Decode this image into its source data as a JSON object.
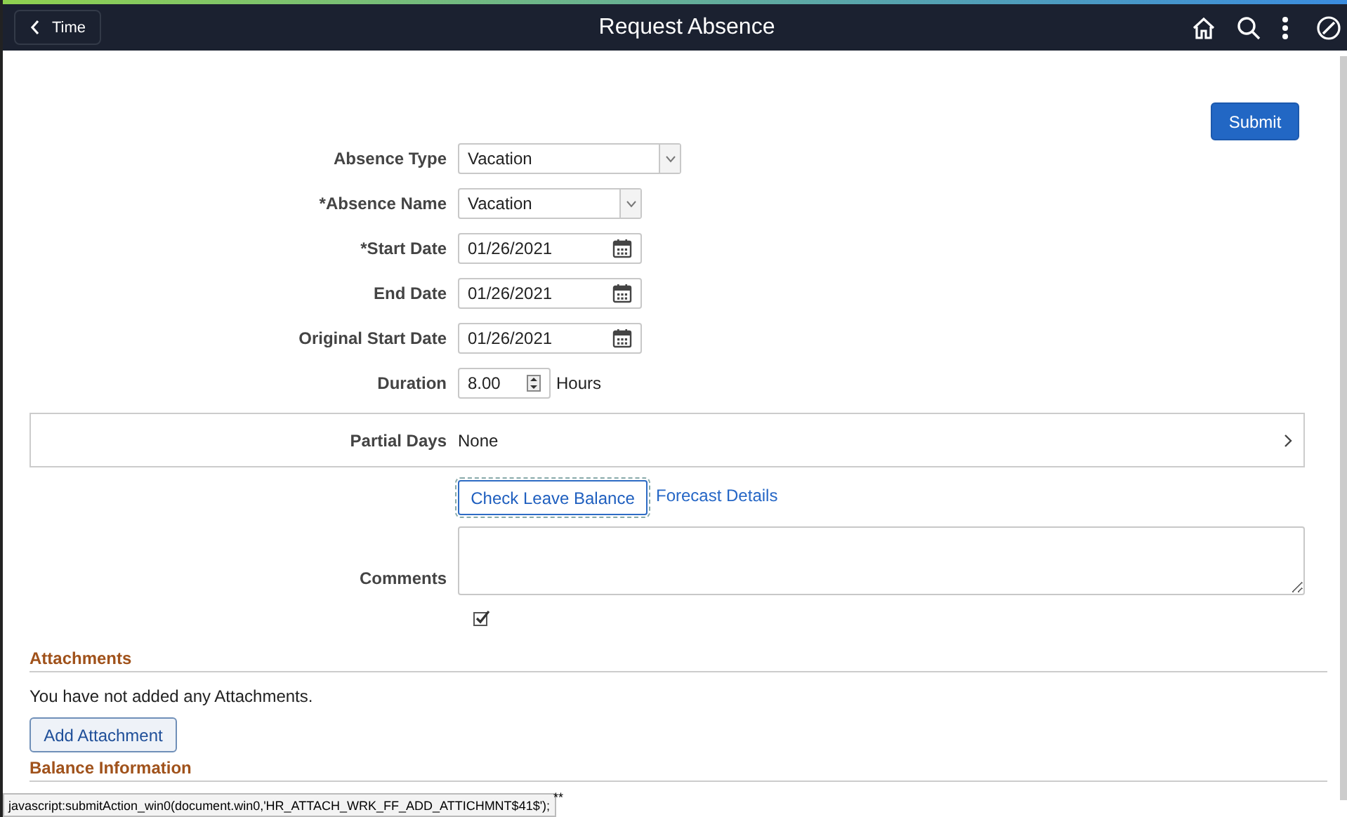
{
  "header": {
    "back_label": "Time",
    "title": "Request Absence"
  },
  "submit": "Submit",
  "fields": [
    {
      "kind": "select",
      "label": "Absence Type",
      "value": "Vacation"
    },
    {
      "kind": "select",
      "label": "*Absence Name",
      "value": "Vacation"
    },
    {
      "kind": "date",
      "label": "*Start Date",
      "value": "01/26/2021"
    },
    {
      "kind": "date",
      "label": "End Date",
      "value": "01/26/2021"
    },
    {
      "kind": "date",
      "label": "Original Start Date",
      "value": "01/26/2021"
    },
    {
      "kind": "number",
      "label": "Duration",
      "value": "8.00",
      "unit": "Hours"
    }
  ],
  "partial_days": {
    "label": "Partial Days",
    "value": "None"
  },
  "check_balance": "Check Leave Balance",
  "forecast_link": "Forecast Details",
  "comments": {
    "label": "Comments"
  },
  "attachments": {
    "heading": "Attachments",
    "message": "You have not added any Attachments.",
    "button": "Add Attachment"
  },
  "balance_heading": "Balance Information",
  "status_bar": {
    "url": "javascript:submitAction_win0(document.win0,'HR_ATTACH_WRK_FF_ADD_ATTICHMNT$41$');",
    "trailing": "**"
  }
}
